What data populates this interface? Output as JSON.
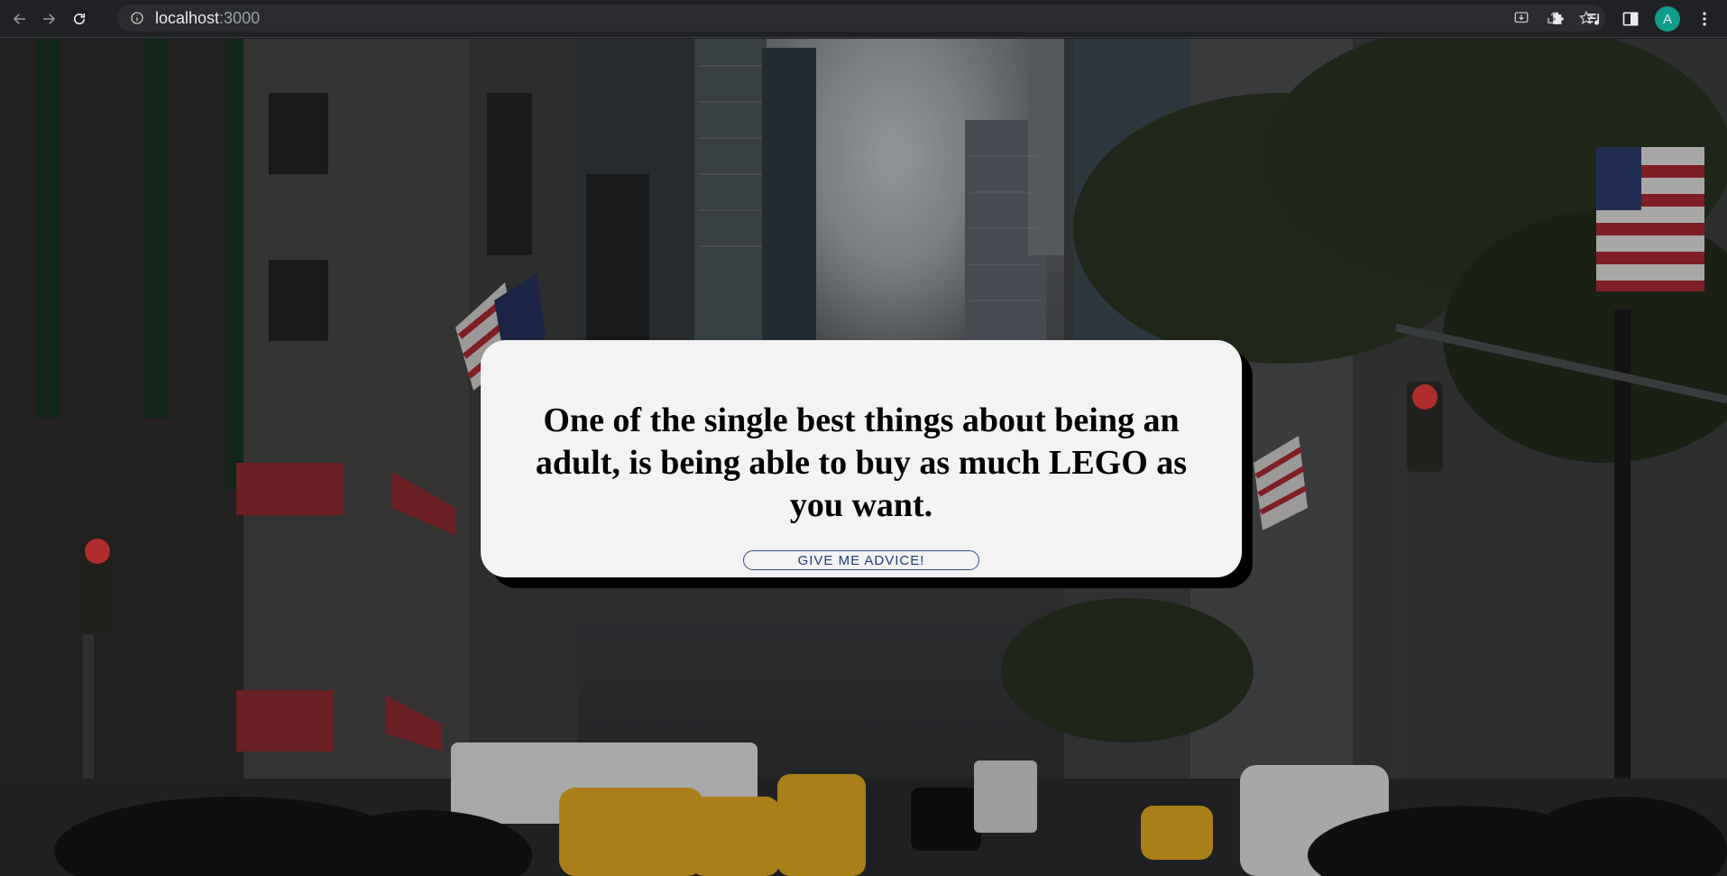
{
  "browser": {
    "url_host": "localhost",
    "url_port": ":3000",
    "profile_initial": "A"
  },
  "card": {
    "quote": "One of the single best things about being an adult, is being able to buy as much LEGO as you want.",
    "button_label": "GIVE ME ADVICE!"
  },
  "background": {
    "description_icon": "city-street-photo"
  }
}
